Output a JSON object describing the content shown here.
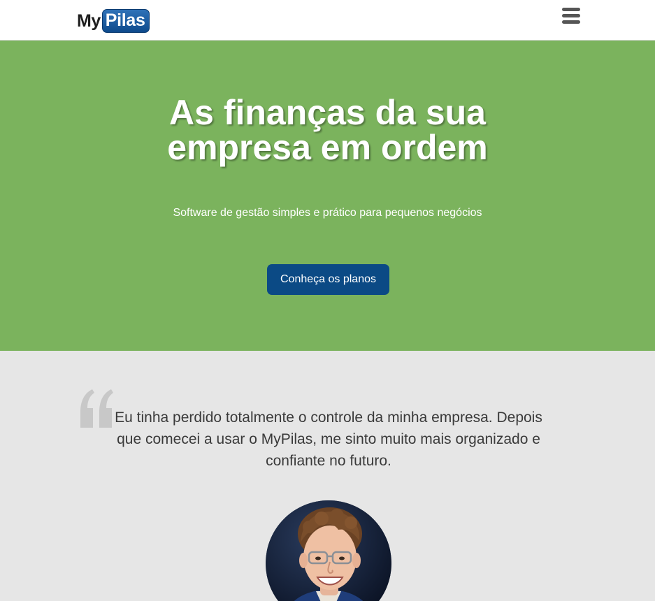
{
  "header": {
    "logo": {
      "part1": "My",
      "part2": "Pilas"
    },
    "menu_icon": "hamburger-menu-icon"
  },
  "hero": {
    "title_line1": "As finanças da sua",
    "title_line2": "empresa em ordem",
    "subtitle": "Software de gestão simples e prático para pequenos negócios",
    "cta_label": "Conheça os planos"
  },
  "testimonial": {
    "quote_icon": "quote-mark-icon",
    "quote": "Eu tinha perdido totalmente o controle da minha empresa. Depois que comecei a usar o MyPilas, me sinto muito mais organizado e confiante no futuro."
  },
  "colors": {
    "hero_bg": "#7bb35d",
    "primary": "#0b4a85",
    "testimonial_bg": "#e6e6e6"
  }
}
